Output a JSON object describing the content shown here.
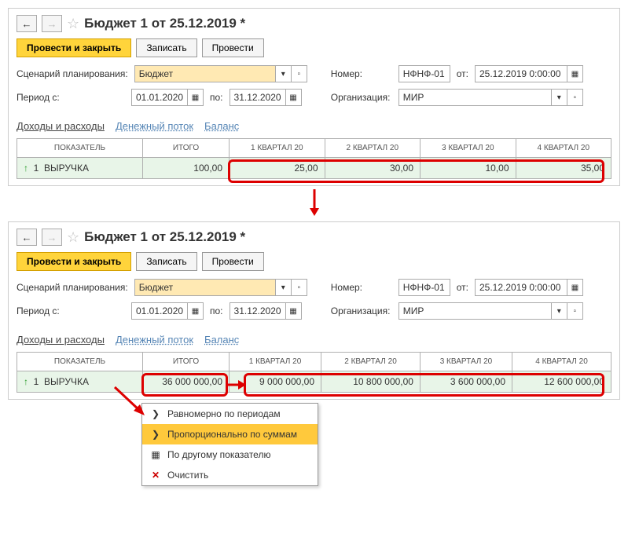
{
  "title": "Бюджет 1 от 25.12.2019 *",
  "toolbar": {
    "post_close": "Провести и закрыть",
    "write": "Записать",
    "post": "Провести"
  },
  "labels": {
    "scenario": "Сценарий планирования:",
    "period_from": "Период с:",
    "to": "по:",
    "number": "Номер:",
    "from_date": "от:",
    "org": "Организация:"
  },
  "fields": {
    "scenario": "Бюджет",
    "date_from": "01.01.2020",
    "date_to": "31.12.2020",
    "number": "НФНФ-01",
    "doc_date": "25.12.2019  0:00:00",
    "org": "МИР"
  },
  "tabs": {
    "t1": "Доходы и расходы",
    "t2": "Денежный поток",
    "t3": "Баланс"
  },
  "grid": {
    "headers": {
      "indicator": "ПОКАЗАТЕЛЬ",
      "total": "ИТОГО",
      "q1": "1 КВАРТАЛ 20",
      "q2": "2 КВАРТАЛ 20",
      "q3": "3 КВАРТАЛ 20",
      "q4": "4 КВАРТАЛ 20"
    },
    "row_num": "1",
    "row_name": "ВЫРУЧКА"
  },
  "top_values": {
    "total": "100,00",
    "q1": "25,00",
    "q2": "30,00",
    "q3": "10,00",
    "q4": "35,00"
  },
  "bottom_values": {
    "total": "36 000 000,00",
    "q1": "9 000 000,00",
    "q2": "10 800 000,00",
    "q3": "3 600 000,00",
    "q4": "12 600 000,00"
  },
  "menu": {
    "m1": "Равномерно по периодам",
    "m2": "Пропорционально по суммам",
    "m3": "По другому показателю",
    "m4": "Очистить"
  }
}
